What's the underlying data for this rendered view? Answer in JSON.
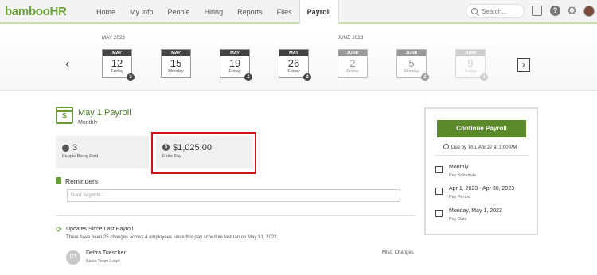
{
  "header": {
    "logo": "bambooHR",
    "nav": [
      "Home",
      "My Info",
      "People",
      "Hiring",
      "Reports",
      "Files",
      "Payroll"
    ],
    "active_nav": "Payroll",
    "search_placeholder": "Search..."
  },
  "calendar": {
    "months": [
      "MAY 2023",
      "JUNE 2023"
    ],
    "days": [
      {
        "month": "MAY",
        "day": "12",
        "weekday": "Friday",
        "badge": "3"
      },
      {
        "month": "MAY",
        "day": "15",
        "weekday": "Monday",
        "badge": ""
      },
      {
        "month": "MAY",
        "day": "19",
        "weekday": "Friday",
        "badge": "2"
      },
      {
        "month": "MAY",
        "day": "26",
        "weekday": "Friday",
        "badge": "3"
      },
      {
        "month": "JUNE",
        "day": "2",
        "weekday": "Friday",
        "badge": ""
      },
      {
        "month": "JUNE",
        "day": "5",
        "weekday": "Monday",
        "badge": "2"
      },
      {
        "month": "JUNE",
        "day": "9",
        "weekday": "Friday",
        "badge": "3"
      }
    ],
    "prev_label": "‹",
    "next_label": "›"
  },
  "payroll": {
    "title": "May 1 Payroll",
    "frequency": "Monthly",
    "people_count": "3",
    "people_label": "People Being Paid",
    "extra_amount": "$1,025.00",
    "extra_label": "Extra Pay"
  },
  "reminders": {
    "title": "Reminders",
    "placeholder": "Don't forget to..."
  },
  "updates": {
    "title": "Updates Since Last Payroll",
    "description": "There have been 25 changes across 4 employees since this pay schedule last ran on May 31, 2022.",
    "person_initials": "DT",
    "person_name": "Debra Tuescher",
    "person_role": "Sales Team Lead",
    "change_type": "Misc. Changes"
  },
  "panel": {
    "button": "Continue Payroll",
    "due": "Due by Thu, Apr 27 at 3:00 PM",
    "schedule": "Monthly",
    "schedule_label": "Pay Schedule",
    "period": "Apr 1, 2023 - Apr 30, 2023",
    "period_label": "Pay Period",
    "date": "Monday, May 1, 2023",
    "date_label": "Pay Date"
  },
  "colors": {
    "brand_green": "#6aa03a",
    "button_green": "#5a8a2a",
    "highlight_red": "#d0141c"
  }
}
